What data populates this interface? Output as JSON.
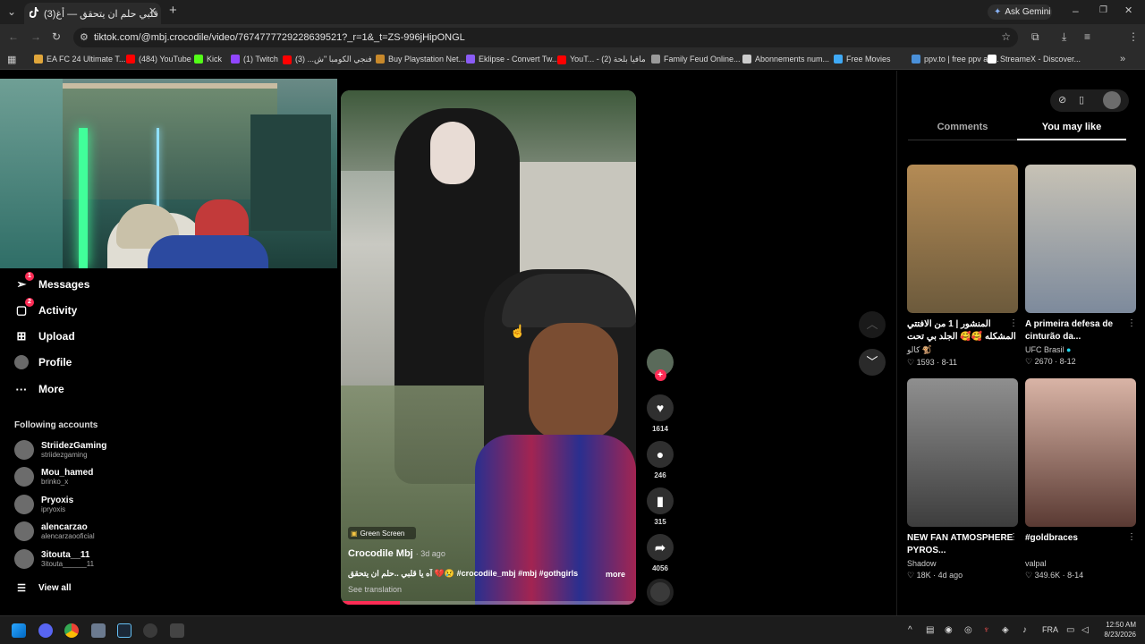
{
  "browser": {
    "tab_title": "(3)آه يا قلبي حلم ان يتحقق — أغ...",
    "url": "tiktok.com/@mbj.crocodile/video/7674777729228639521?_r=1&_t=ZS-996jHipONGL",
    "ask_gemini": "Ask Gemini",
    "bookmarks": [
      {
        "label": "EA FC 24 Ultimate T...",
        "color": "#e0a63b"
      },
      {
        "label": "(484) YouTube",
        "color": "#ff0000"
      },
      {
        "label": "Kick",
        "color": "#53fc18"
      },
      {
        "label": "(1) Twitch",
        "color": "#9146ff"
      },
      {
        "label": "فنجي الكومبا \"ش... (3)",
        "color": "#ff0000"
      },
      {
        "label": "Buy Playstation Net...",
        "color": "#c8892b"
      },
      {
        "label": "Eklipse - Convert Tw...",
        "color": "#8b5cf6"
      },
      {
        "label": "YouT... - مافيا بلحة (2)",
        "color": "#ff0000"
      },
      {
        "label": "Family Feud Online...",
        "color": "#9a9a9a"
      },
      {
        "label": "Abonnements num...",
        "color": "#cccccc"
      },
      {
        "label": "Free Movies",
        "color": "#3fa9f5"
      },
      {
        "label": "ppv.to | free ppv an...",
        "color": "#4a90d9"
      },
      {
        "label": "StreameX - Discover...",
        "color": "#ffffff"
      }
    ]
  },
  "sidebar": {
    "nav": [
      {
        "label": "Messages",
        "icon": "send-icon",
        "badge": "1"
      },
      {
        "label": "Activity",
        "icon": "activity-icon",
        "badge": "2"
      },
      {
        "label": "Upload",
        "icon": "upload-icon",
        "badge": ""
      },
      {
        "label": "Profile",
        "icon": "avatar",
        "badge": ""
      },
      {
        "label": "More",
        "icon": "more-icon",
        "badge": ""
      }
    ],
    "following_title": "Following accounts",
    "following": [
      {
        "name": "StriidezGaming",
        "handle": "striidezgaming"
      },
      {
        "name": "Mou_hamed",
        "handle": "brinko_x"
      },
      {
        "name": "Pryoxis",
        "handle": "ipryoxis"
      },
      {
        "name": "alencarzao",
        "handle": "alencarzaooficial"
      },
      {
        "name": "3itouta__11",
        "handle": "3itouta______11"
      }
    ],
    "view_all": "View all"
  },
  "video": {
    "effect": "Green Screen",
    "author": "Crocodile Mbj",
    "age": "· 3d ago",
    "caption": "آه يا قلبي ..حلم ان يتحقق 💔😢 #crocodile_mbj #mbj #gothgirls",
    "more": "more",
    "see_translation": "See translation",
    "likes": "1614",
    "comments": "246",
    "saves": "315",
    "shares": "4056"
  },
  "right_panel": {
    "tabs": [
      "Comments",
      "You may like"
    ],
    "active_tab": "You may like",
    "cards": [
      {
        "title": "المنشور | 1 من الافتتي المشكله 🥰🥰 الجلد بي تحت ما ركزوا ...",
        "author": "كالو 🐒",
        "likes": "1593",
        "date": "8-11",
        "colors": [
          "#b48b55",
          "#6c5a3c"
        ]
      },
      {
        "title": "A primeira defesa de cinturão da...",
        "author": "UFC Brasil",
        "verified": true,
        "likes": "2670",
        "date": "8-12",
        "colors": [
          "#c7c2b5",
          "#7d8a9c"
        ]
      },
      {
        "title": "NEW FAN ATMOSPHERE PYROS...",
        "author": "Shadow",
        "likes": "18K",
        "date": "4d ago",
        "colors": [
          "#8f8f8f",
          "#3d3d3d"
        ]
      },
      {
        "title": "#goldbraces",
        "author": "valpal",
        "likes": "349.6K",
        "date": "8-14",
        "colors": [
          "#d9b4a6",
          "#5a3a33"
        ]
      }
    ]
  },
  "taskbar": {
    "lang": "FRA",
    "time": "12:50 AM",
    "date": "8/23/2026"
  }
}
